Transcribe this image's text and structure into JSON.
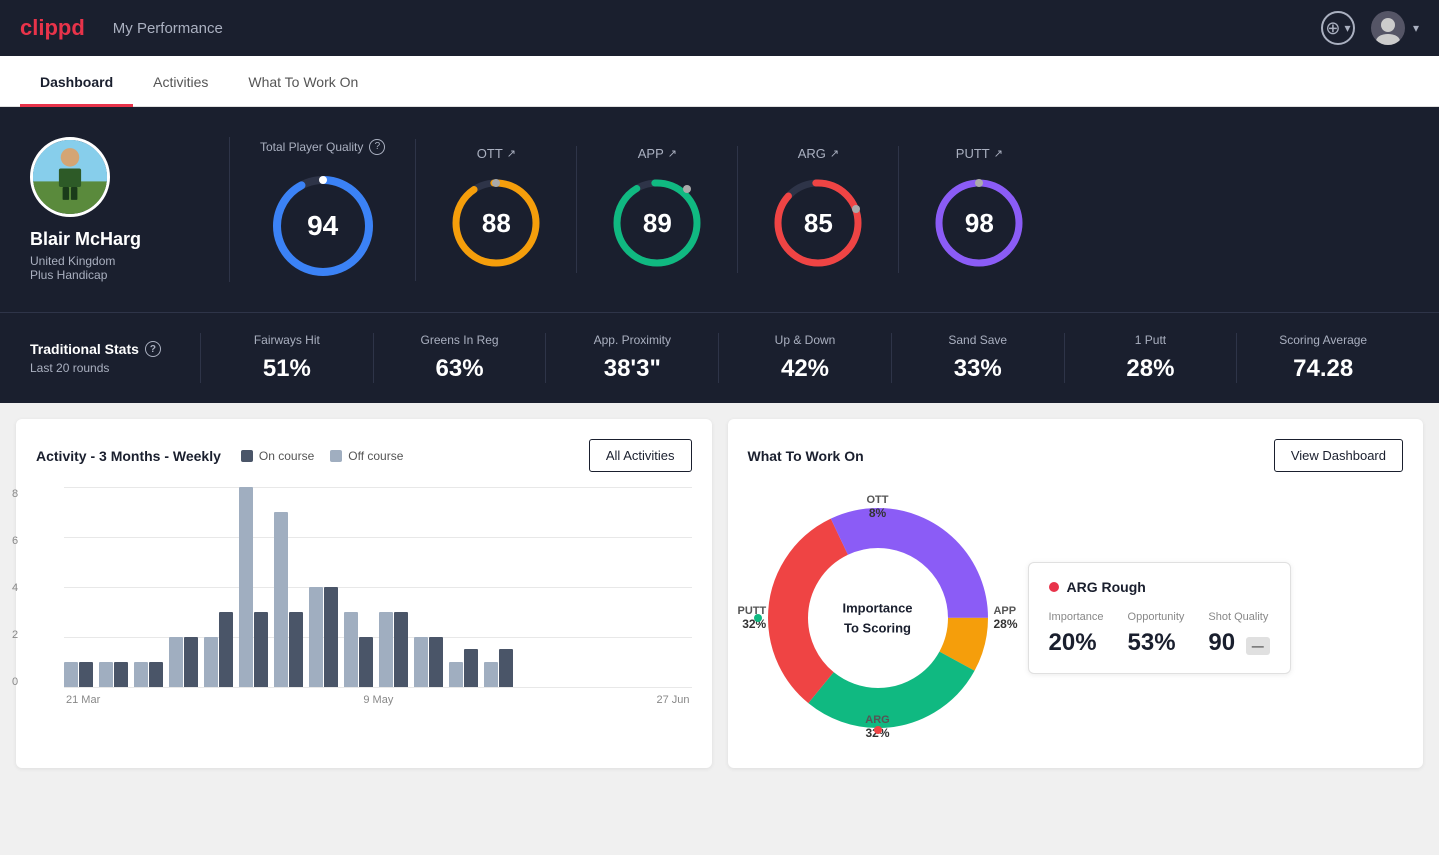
{
  "nav": {
    "logo": "clippd",
    "title": "My Performance",
    "add_button_label": "+",
    "chevron": "▾"
  },
  "tabs": [
    {
      "label": "Dashboard",
      "active": true
    },
    {
      "label": "Activities",
      "active": false
    },
    {
      "label": "What To Work On",
      "active": false
    }
  ],
  "player": {
    "name": "Blair McHarg",
    "country": "United Kingdom",
    "handicap": "Plus Handicap"
  },
  "total_quality": {
    "label": "Total Player Quality",
    "value": 94,
    "color": "#3b82f6"
  },
  "sub_scores": [
    {
      "key": "OTT",
      "value": 88,
      "color": "#f59e0b",
      "arrow": "↗"
    },
    {
      "key": "APP",
      "value": 89,
      "color": "#10b981",
      "arrow": "↗"
    },
    {
      "key": "ARG",
      "value": 85,
      "color": "#ef4444",
      "arrow": "↗"
    },
    {
      "key": "PUTT",
      "value": 98,
      "color": "#8b5cf6",
      "arrow": "↗"
    }
  ],
  "trad_stats": {
    "label": "Traditional Stats",
    "sub_label": "Last 20 rounds",
    "items": [
      {
        "name": "Fairways Hit",
        "value": "51%"
      },
      {
        "name": "Greens In Reg",
        "value": "63%"
      },
      {
        "name": "App. Proximity",
        "value": "38'3\""
      },
      {
        "name": "Up & Down",
        "value": "42%"
      },
      {
        "name": "Sand Save",
        "value": "33%"
      },
      {
        "name": "1 Putt",
        "value": "28%"
      },
      {
        "name": "Scoring Average",
        "value": "74.28"
      }
    ]
  },
  "activity_chart": {
    "title": "Activity - 3 Months - Weekly",
    "legend": {
      "on_course": "On course",
      "off_course": "Off course"
    },
    "button": "All Activities",
    "x_labels": [
      "21 Mar",
      "9 May",
      "27 Jun"
    ],
    "y_labels": [
      "0",
      "2",
      "4",
      "6",
      "8"
    ],
    "bars": [
      {
        "on": 1,
        "off": 1
      },
      {
        "on": 1,
        "off": 1
      },
      {
        "on": 1,
        "off": 1
      },
      {
        "on": 2,
        "off": 2
      },
      {
        "on": 3,
        "off": 2
      },
      {
        "on": 4,
        "off": 8
      },
      {
        "on": 3,
        "off": 7
      },
      {
        "on": 4,
        "off": 4
      },
      {
        "on": 2,
        "off": 3
      },
      {
        "on": 3,
        "off": 3
      },
      {
        "on": 2,
        "off": 2
      },
      {
        "on": 1,
        "off": 0.5
      },
      {
        "on": 0.5,
        "off": 0.5
      }
    ]
  },
  "what_to_work_on": {
    "title": "What To Work On",
    "button": "View Dashboard",
    "donut_center": "Importance\nTo Scoring",
    "segments": [
      {
        "label": "OTT",
        "value": "8%",
        "color": "#f59e0b"
      },
      {
        "label": "APP",
        "value": "28%",
        "color": "#10b981"
      },
      {
        "label": "ARG",
        "value": "32%",
        "color": "#ef4444"
      },
      {
        "label": "PUTT",
        "value": "32%",
        "color": "#8b5cf6"
      }
    ],
    "card": {
      "title": "ARG Rough",
      "metrics": [
        {
          "label": "Importance",
          "value": "20%"
        },
        {
          "label": "Opportunity",
          "value": "53%"
        },
        {
          "label": "Shot Quality",
          "value": "90",
          "badge": "—"
        }
      ]
    }
  }
}
